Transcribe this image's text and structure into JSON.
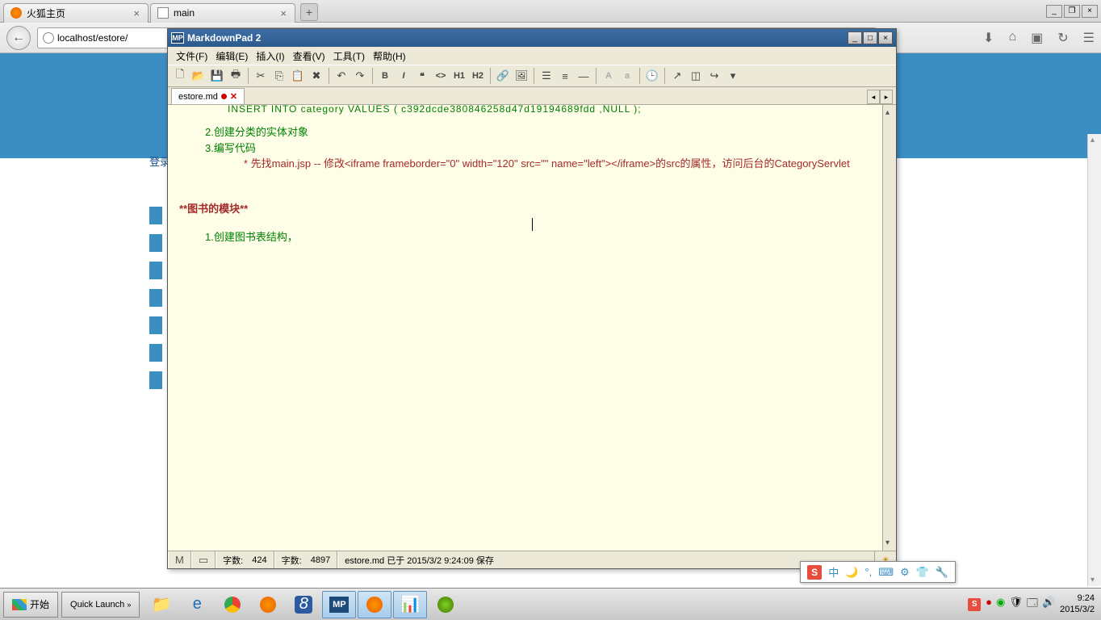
{
  "browser": {
    "tabs": [
      {
        "label": "火狐主页",
        "icon": "firefox"
      },
      {
        "label": "main",
        "icon": "page"
      }
    ],
    "url": "localhost/estore/",
    "nav_icons": [
      "download",
      "home",
      "bookmark",
      "sync",
      "menu"
    ]
  },
  "page": {
    "login_text": "登录"
  },
  "mdp": {
    "title": "MarkdownPad 2",
    "title_badge": "MP",
    "menu": [
      "文件(F)",
      "编辑(E)",
      "插入(I)",
      "查看(V)",
      "工具(T)",
      "帮助(H)"
    ],
    "tab": {
      "name": "estore.md"
    },
    "content": {
      "line_cut": "INSERT INTO `category` VALUES ('c392dcde380846258d47d19194689fdd',NULL);",
      "line2": "2.创建分类的实体对象",
      "line3": "3.编写代码",
      "line4": "* 先找main.jsp -- 修改<iframe frameborder=\"0\" width=\"120\" src=\"\" name=\"left\"></iframe>的src的属性，访问后台的CategoryServlet",
      "heading": "**图书的模块**",
      "line5": "1.创建图书表结构，"
    },
    "status": {
      "words_label": "字数:",
      "words": "424",
      "chars_label": "字数:",
      "chars": "4897",
      "file_msg": "estore.md 已于 2015/3/2 9:24:09 保存"
    }
  },
  "tray": {
    "items": [
      "中",
      "🌙",
      "°,",
      "⌨",
      "⚙",
      "👕",
      "🔧"
    ]
  },
  "taskbar": {
    "start": "开始",
    "quick": "Quick Launch",
    "chevron": "»",
    "clock_time": "9:24",
    "clock_date": "2015/3/2"
  }
}
